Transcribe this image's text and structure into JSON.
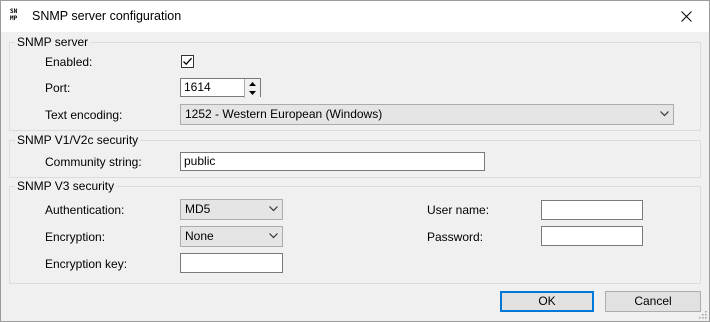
{
  "window": {
    "title": "SNMP server configuration",
    "icon_text_top": "SN",
    "icon_text_bottom": "MP",
    "close_icon": "close-icon"
  },
  "snmp_server": {
    "legend": "SNMP server",
    "enabled_label": "Enabled:",
    "enabled_checked": true,
    "port_label": "Port:",
    "port_value": "1614",
    "encoding_label": "Text encoding:",
    "encoding_value": "1252 - Western European (Windows)"
  },
  "v1v2c": {
    "legend": "SNMP V1/V2c security",
    "community_label": "Community string:",
    "community_value": "public"
  },
  "v3": {
    "legend": "SNMP V3 security",
    "auth_label": "Authentication:",
    "auth_value": "MD5",
    "encryption_label": "Encryption:",
    "encryption_value": "None",
    "key_label": "Encryption key:",
    "key_value": "",
    "username_label": "User name:",
    "username_value": "",
    "password_label": "Password:",
    "password_value": ""
  },
  "buttons": {
    "ok": "OK",
    "cancel": "Cancel"
  },
  "colors": {
    "accent": "#0078d7",
    "window_bg": "#f0f0f0",
    "titlebar_bg": "#ffffff"
  }
}
